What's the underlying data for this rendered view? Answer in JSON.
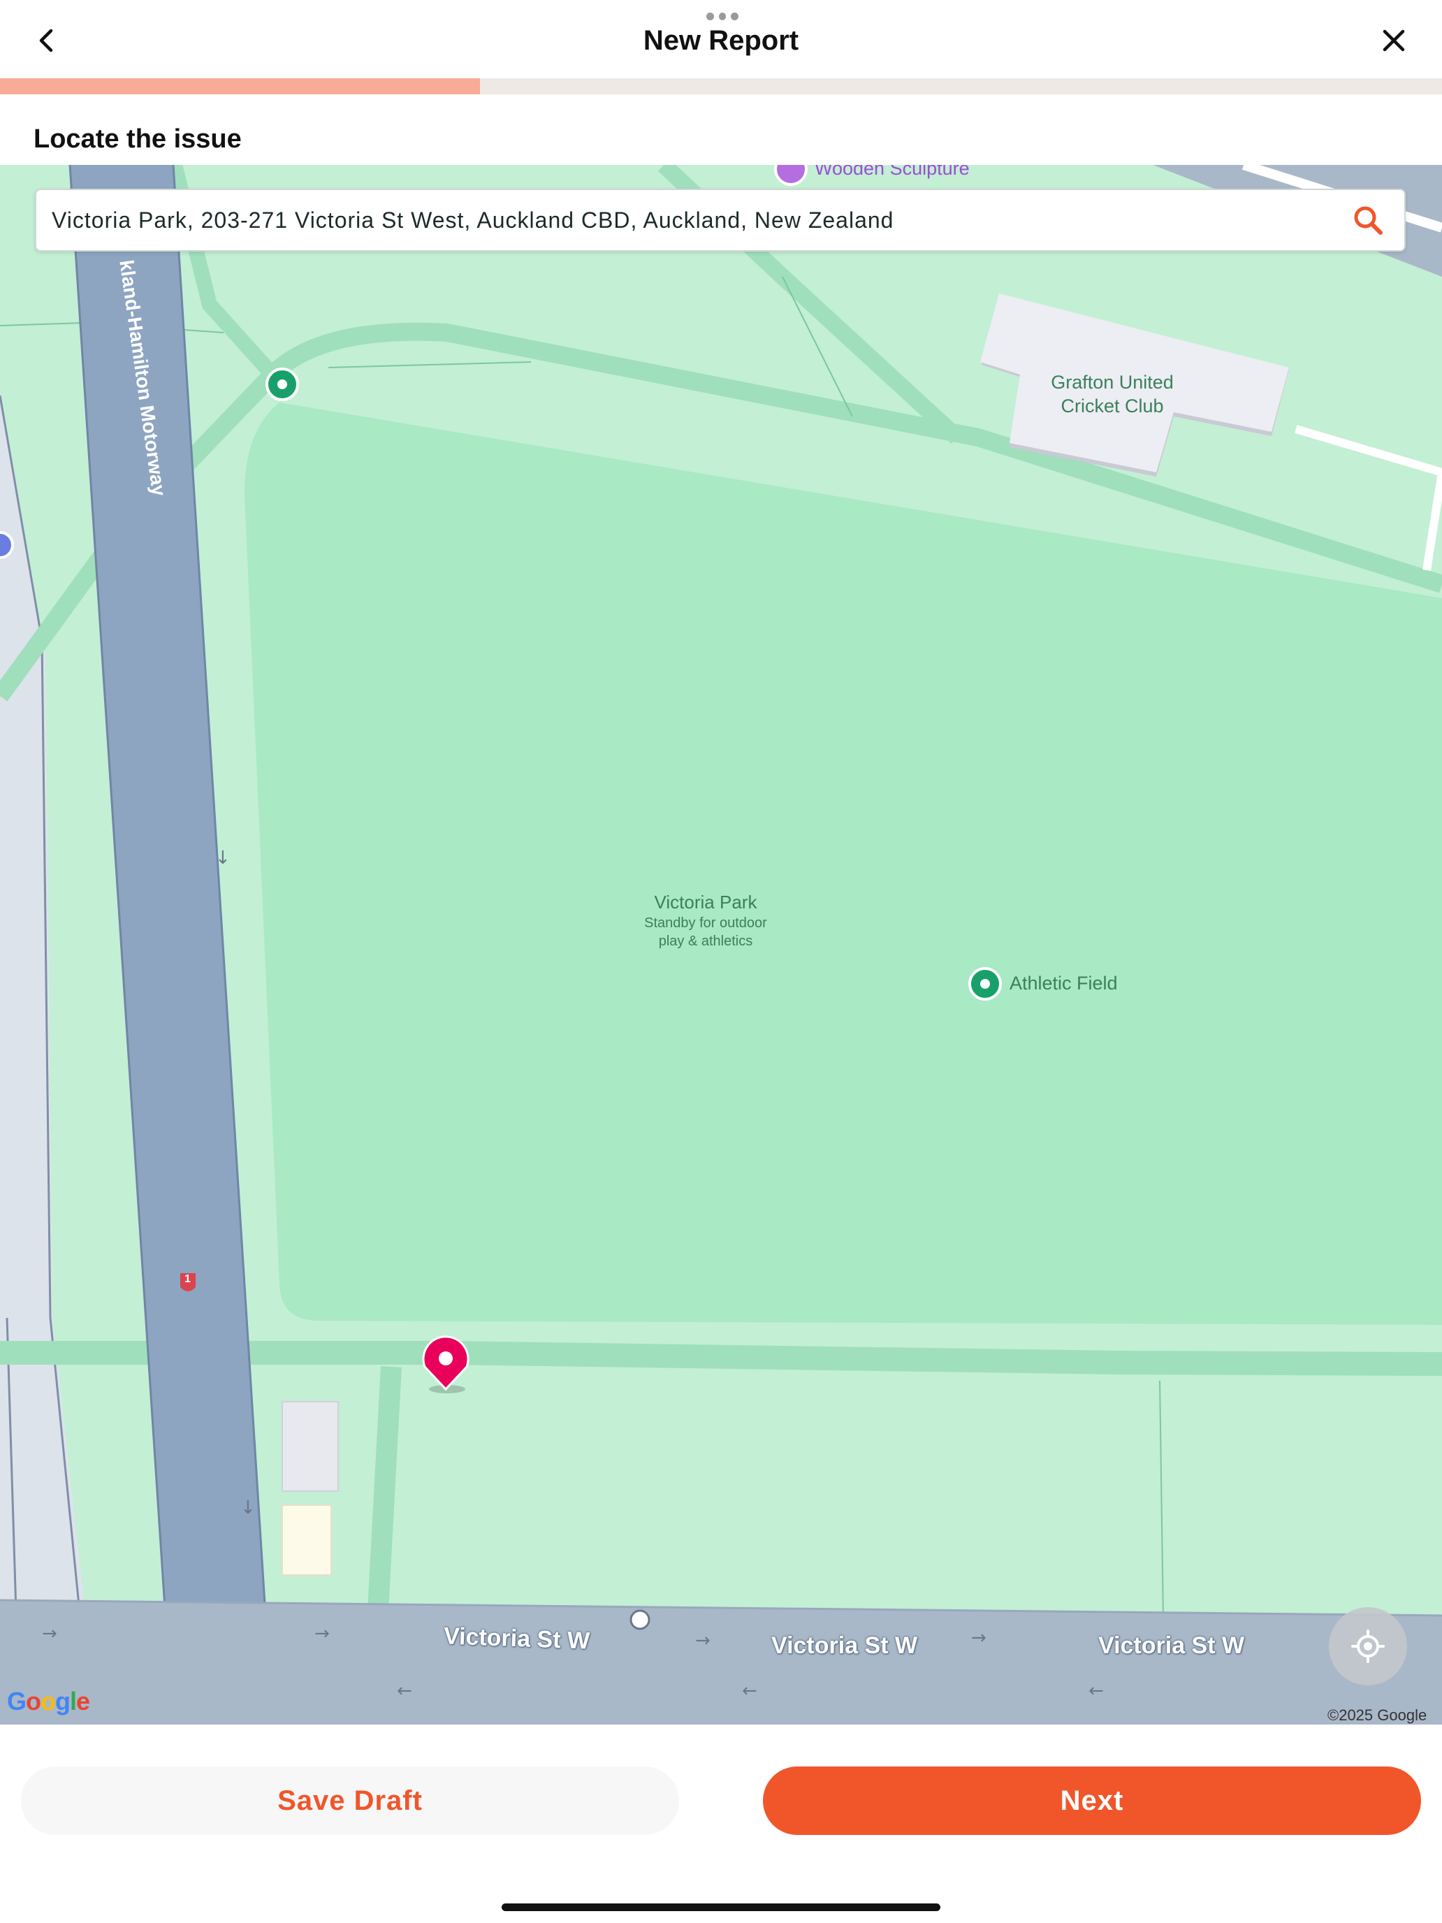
{
  "header": {
    "title": "New Report",
    "back_icon": "chevron-left-icon",
    "close_icon": "close-icon",
    "progress_fraction": 0.333
  },
  "section": {
    "label": "Locate the issue"
  },
  "search": {
    "value": "Victoria Park, 203-271 Victoria St West, Auckland CBD, Auckland, New Zealand",
    "icon": "search-icon",
    "accent": "#f0562a"
  },
  "map": {
    "labels": {
      "motorway": "kland-Hamilton Motorway",
      "sculpture": "Wooden Sculpture",
      "cricket_club_line1": "Grafton United",
      "cricket_club_line2": "Cricket Club",
      "park_name": "Victoria Park",
      "park_sub1": "Standby for outdoor",
      "park_sub2": "play & athletics",
      "athletic_field": "Athletic Field",
      "street_1": "Victoria St W",
      "street_2": "Victoria St W",
      "street_3": "Victoria St W",
      "state_highway": "1"
    },
    "google_logo": "Google",
    "copyright": "©2025 Google",
    "pin_color": "#e8005b",
    "locate_icon": "my-location-icon"
  },
  "footer": {
    "save_draft_label": "Save Draft",
    "next_label": "Next"
  }
}
